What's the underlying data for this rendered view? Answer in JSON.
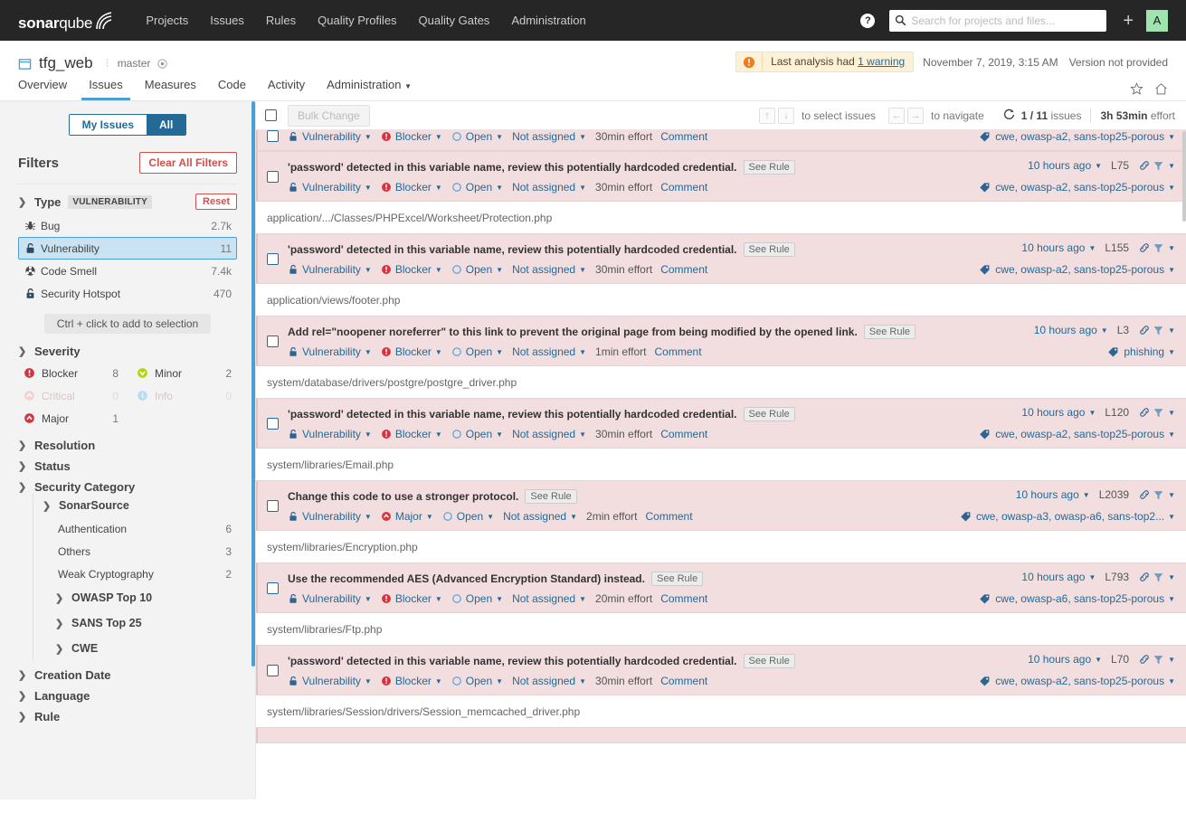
{
  "global_nav": {
    "brand_bold": "sonar",
    "brand_light": "qube",
    "links": [
      "Projects",
      "Issues",
      "Rules",
      "Quality Profiles",
      "Quality Gates",
      "Administration"
    ],
    "help_label": "?",
    "search_placeholder": "Search for projects and files...",
    "search_value": "",
    "plus_label": "+",
    "avatar_initial": "A"
  },
  "context_nav": {
    "project_name": "tfg_web",
    "branch": "master",
    "warning_prefix": "Last analysis had ",
    "warning_link": "1 warning",
    "analysis_date": "November 7, 2019, 3:15 AM",
    "version": "Version not provided",
    "tabs": [
      "Overview",
      "Issues",
      "Measures",
      "Code",
      "Activity",
      "Administration"
    ],
    "active_tab": "Issues"
  },
  "sidebar": {
    "segment": {
      "left": "My Issues",
      "right": "All",
      "active": "All"
    },
    "filters_title": "Filters",
    "clear_all": "Clear All Filters",
    "type_facet": {
      "title": "Type",
      "badge": "VULNERABILITY",
      "reset": "Reset",
      "items": [
        {
          "label": "Bug",
          "count": "2.7k",
          "icon": "bug-icon",
          "selected": false
        },
        {
          "label": "Vulnerability",
          "count": "11",
          "icon": "vulnerability-icon",
          "selected": true
        },
        {
          "label": "Code Smell",
          "count": "7.4k",
          "icon": "code-smell-icon",
          "selected": false
        },
        {
          "label": "Security Hotspot",
          "count": "470",
          "icon": "security-hotspot-icon",
          "selected": false
        }
      ],
      "hint": "Ctrl + click to add to selection"
    },
    "severity_facet": {
      "title": "Severity",
      "items": [
        {
          "label": "Blocker",
          "count": "8",
          "icon": "blocker-icon",
          "disabled": false
        },
        {
          "label": "Minor",
          "count": "2",
          "icon": "minor-icon",
          "disabled": false
        },
        {
          "label": "Critical",
          "count": "0",
          "icon": "critical-icon",
          "disabled": true
        },
        {
          "label": "Info",
          "count": "0",
          "icon": "info-icon",
          "disabled": true
        },
        {
          "label": "Major",
          "count": "1",
          "icon": "major-icon",
          "disabled": false
        }
      ]
    },
    "resolution_facet": {
      "title": "Resolution"
    },
    "status_facet": {
      "title": "Status"
    },
    "security_category_facet": {
      "title": "Security Category",
      "sonarsource": {
        "title": "SonarSource",
        "items": [
          {
            "label": "Authentication",
            "count": "6"
          },
          {
            "label": "Others",
            "count": "3"
          },
          {
            "label": "Weak Cryptography",
            "count": "2"
          }
        ]
      },
      "groups": [
        "OWASP Top 10",
        "SANS Top 25",
        "CWE"
      ]
    },
    "creation_date_facet": {
      "title": "Creation Date"
    },
    "language_facet": {
      "title": "Language"
    },
    "rule_facet": {
      "title": "Rule"
    }
  },
  "toolbar": {
    "bulk_change": "Bulk Change",
    "select_keys": [
      "↑",
      "↓"
    ],
    "select_label": "to select issues",
    "nav_keys": [
      "←",
      "→"
    ],
    "nav_label": "to navigate",
    "issues_count": "1 / 11",
    "issues_label": "issues",
    "effort_value": "3h 53min",
    "effort_label": "effort"
  },
  "issues": [
    {
      "partial_top": true,
      "message": "",
      "see_rule": "",
      "type": "Vulnerability",
      "severity": "Blocker",
      "severity_icon": "blocker-icon",
      "status": "Open",
      "assignee": "Not assigned",
      "effort": "30min effort",
      "comment": "Comment",
      "age": "",
      "line": "",
      "tags": "cwe, owasp-a2, sans-top25-porous"
    },
    {
      "message": "'password' detected in this variable name, review this potentially hardcoded credential.",
      "see_rule": "See Rule",
      "type": "Vulnerability",
      "severity": "Blocker",
      "severity_icon": "blocker-icon",
      "status": "Open",
      "assignee": "Not assigned",
      "effort": "30min effort",
      "comment": "Comment",
      "age": "10 hours ago",
      "line": "L75",
      "tags": "cwe, owasp-a2, sans-top25-porous"
    },
    {
      "component": "application/.../Classes/PHPExcel/Worksheet/Protection.php",
      "message": "'password' detected in this variable name, review this potentially hardcoded credential.",
      "see_rule": "See Rule",
      "type": "Vulnerability",
      "severity": "Blocker",
      "severity_icon": "blocker-icon",
      "status": "Open",
      "assignee": "Not assigned",
      "effort": "30min effort",
      "comment": "Comment",
      "age": "10 hours ago",
      "line": "L155",
      "tags": "cwe, owasp-a2, sans-top25-porous"
    },
    {
      "component": "application/views/footer.php",
      "message": "Add rel=\"noopener noreferrer\" to this link to prevent the original page from being modified by the opened link.",
      "see_rule": "See Rule",
      "type": "Vulnerability",
      "severity": "Blocker",
      "severity_icon": "blocker-icon",
      "status": "Open",
      "assignee": "Not assigned",
      "effort": "1min effort",
      "comment": "Comment",
      "age": "10 hours ago",
      "line": "L3",
      "tags": "phishing"
    },
    {
      "component": "system/database/drivers/postgre/postgre_driver.php",
      "message": "'password' detected in this variable name, review this potentially hardcoded credential.",
      "see_rule": "See Rule",
      "type": "Vulnerability",
      "severity": "Blocker",
      "severity_icon": "blocker-icon",
      "status": "Open",
      "assignee": "Not assigned",
      "effort": "30min effort",
      "comment": "Comment",
      "age": "10 hours ago",
      "line": "L120",
      "tags": "cwe, owasp-a2, sans-top25-porous"
    },
    {
      "component": "system/libraries/Email.php",
      "message": "Change this code to use a stronger protocol.",
      "see_rule": "See Rule",
      "type": "Vulnerability",
      "severity": "Major",
      "severity_icon": "major-icon",
      "status": "Open",
      "assignee": "Not assigned",
      "effort": "2min effort",
      "comment": "Comment",
      "age": "10 hours ago",
      "line": "L2039",
      "tags": "cwe, owasp-a3, owasp-a6, sans-top2..."
    },
    {
      "component": "system/libraries/Encryption.php",
      "message": "Use the recommended AES (Advanced Encryption Standard) instead.",
      "see_rule": "See Rule",
      "type": "Vulnerability",
      "severity": "Blocker",
      "severity_icon": "blocker-icon",
      "status": "Open",
      "assignee": "Not assigned",
      "effort": "20min effort",
      "comment": "Comment",
      "age": "10 hours ago",
      "line": "L793",
      "tags": "cwe, owasp-a6, sans-top25-porous"
    },
    {
      "component": "system/libraries/Ftp.php",
      "message": "'password' detected in this variable name, review this potentially hardcoded credential.",
      "see_rule": "See Rule",
      "type": "Vulnerability",
      "severity": "Blocker",
      "severity_icon": "blocker-icon",
      "status": "Open",
      "assignee": "Not assigned",
      "effort": "30min effort",
      "comment": "Comment",
      "age": "10 hours ago",
      "line": "L70",
      "tags": "cwe, owasp-a2, sans-top25-porous"
    },
    {
      "component": "system/libraries/Session/drivers/Session_memcached_driver.php",
      "partial_bottom": true,
      "message": "",
      "see_rule": "",
      "type": "",
      "severity": "",
      "status": "",
      "assignee": "",
      "effort": "",
      "comment": "",
      "age": "",
      "line": "",
      "tags": ""
    }
  ],
  "colors": {
    "nav_bg": "#262626",
    "accent_blue": "#4b9fd5",
    "link_blue": "#236a97",
    "issue_bg": "#f2dede",
    "blocker_red": "#d4333f",
    "major_red": "#d4333f",
    "minor_green": "#b0d513",
    "info_blue": "#99d0f5",
    "avatar_green": "#9fe3b0",
    "warning_bg": "#fdf2d8",
    "warning_orange": "#ed7d20"
  }
}
